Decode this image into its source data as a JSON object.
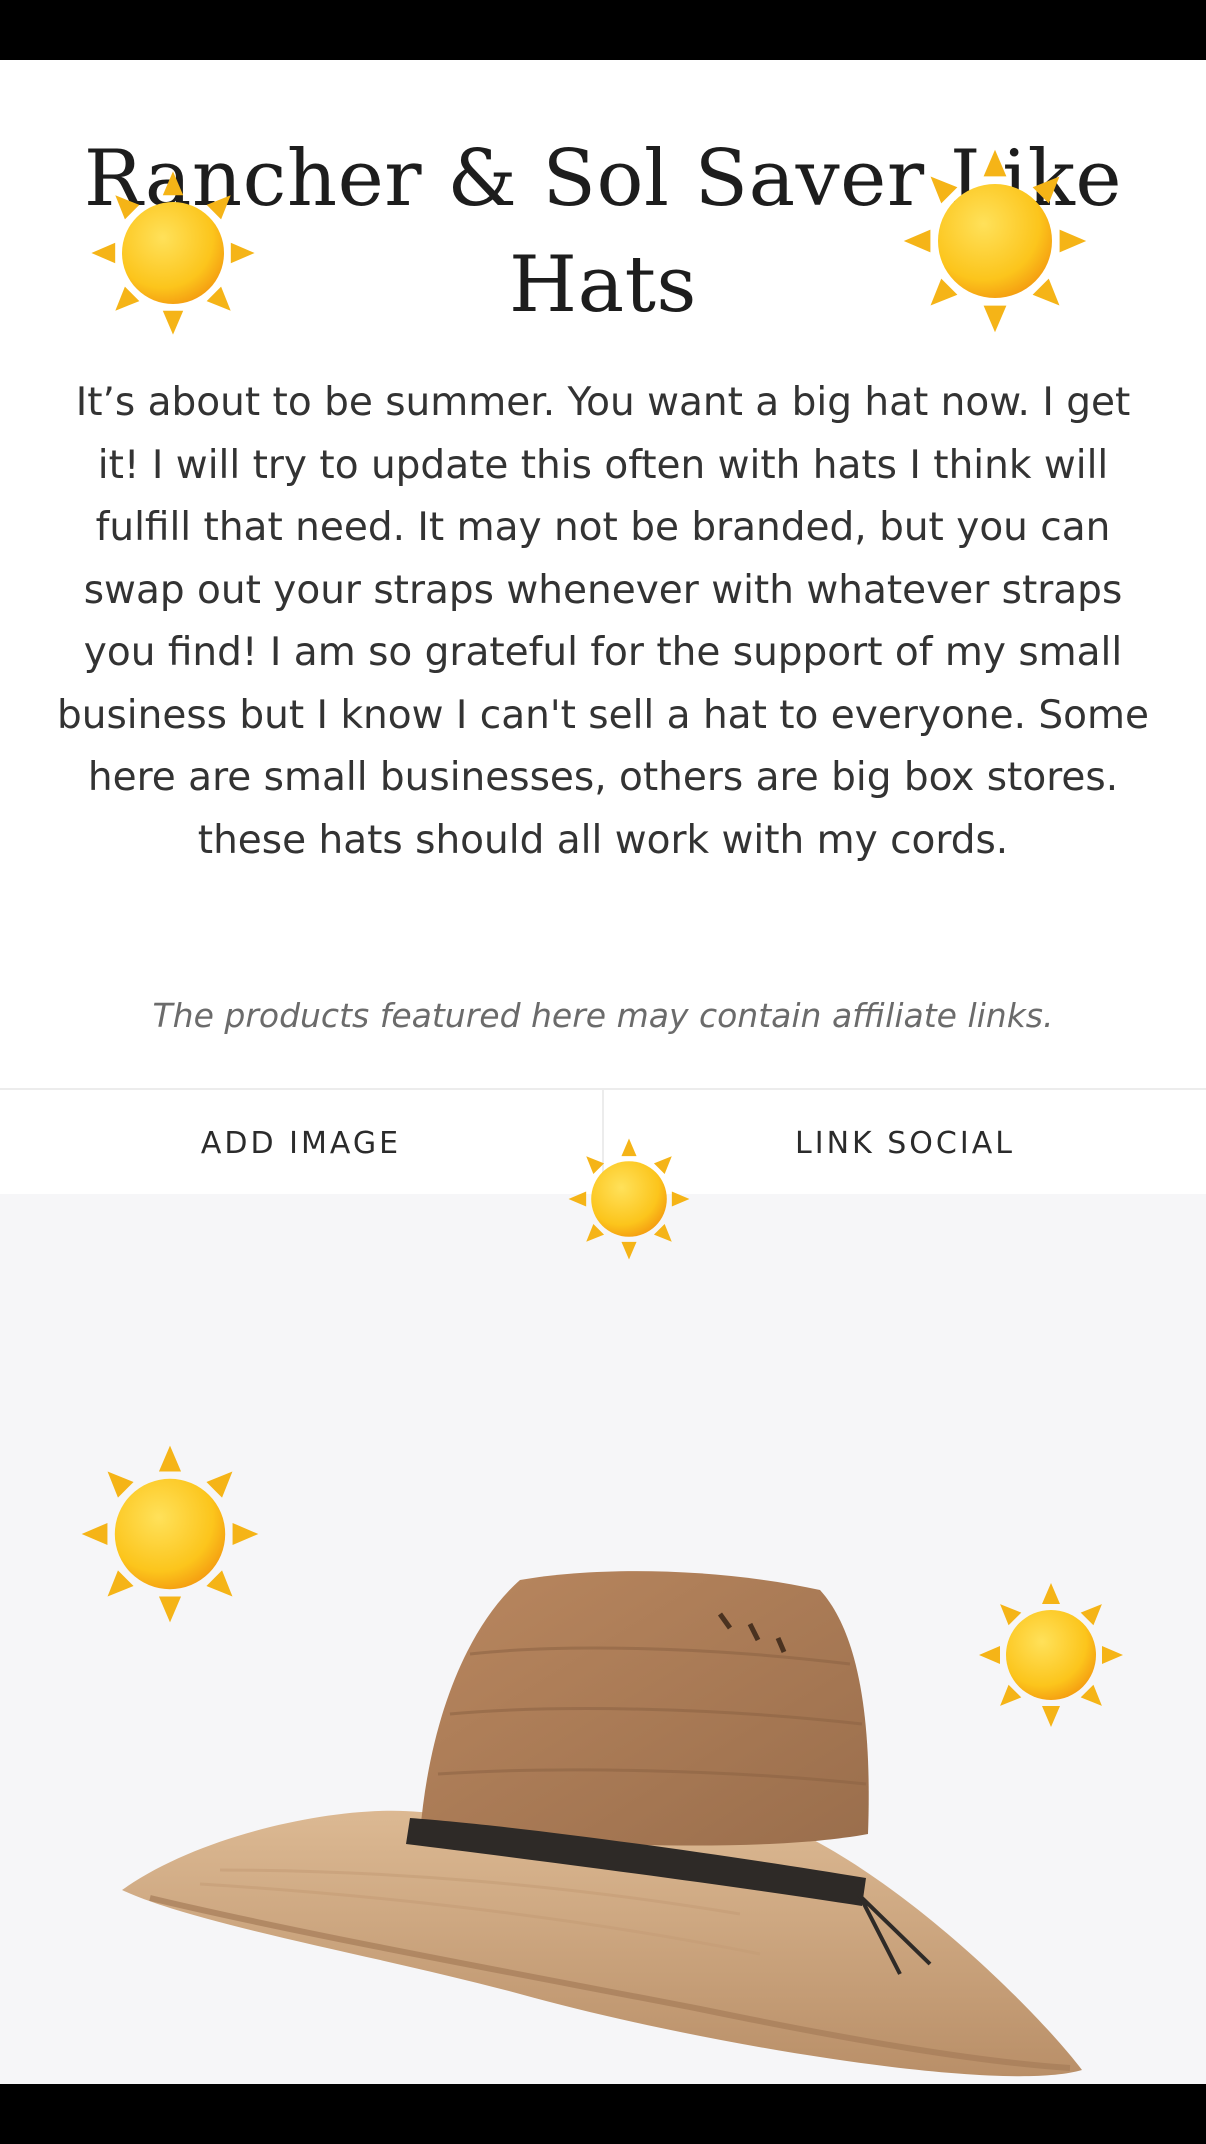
{
  "page": {
    "title": "Rancher & Sol Saver Like Hats",
    "description": "It’s about to be summer. You want a big hat now. I get it! I will try to update this often with hats I think will fulfill that need. It may not be branded, but you can swap out your straps whenever with whatever straps you find! I am so grateful for the support of my small business but I know I can't sell a hat to everyone. Some here are small businesses, others are big box stores. these hats should all work with my cords.",
    "disclaimer": "The products featured here may contain affiliate links."
  },
  "actions": {
    "add_image_label": "ADD IMAGE",
    "link_social_label": "LINK SOCIAL"
  },
  "stickers": {
    "icon": "sun-icon",
    "colors": {
      "ray": "#f5b417",
      "core": "#fcc51c",
      "core_dark": "#f49a10"
    }
  },
  "product": {
    "image_icon": "straw-hat-image",
    "colors": {
      "straw": "#b98b63",
      "brim": "#d8b28d",
      "band": "#2e2a27"
    }
  }
}
